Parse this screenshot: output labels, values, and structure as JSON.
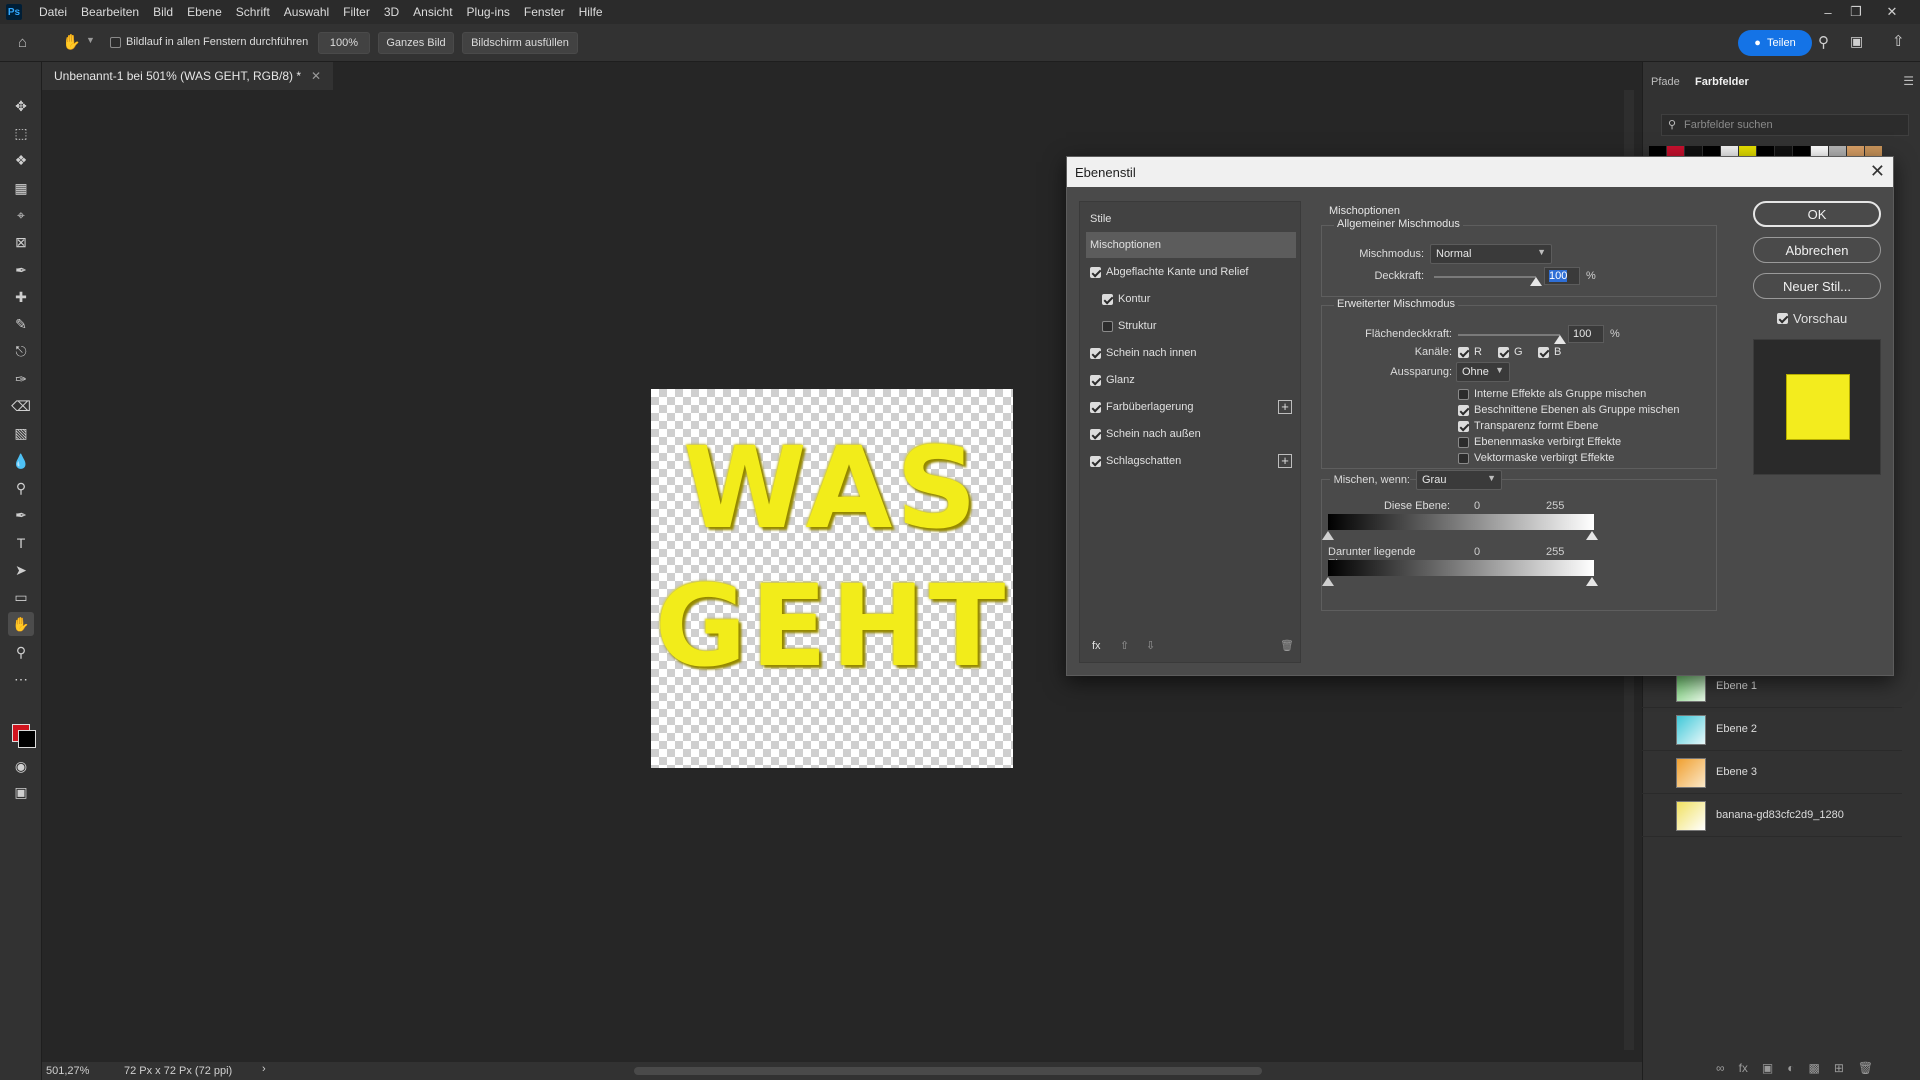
{
  "menubar": {
    "logo": "Ps",
    "items": [
      "Datei",
      "Bearbeiten",
      "Bild",
      "Ebene",
      "Schrift",
      "Auswahl",
      "Filter",
      "3D",
      "Ansicht",
      "Plug-ins",
      "Fenster",
      "Hilfe"
    ]
  },
  "optbar": {
    "scroll_all_label": "Bildlauf in allen Fenstern durchführen",
    "zoom_btn": "100%",
    "fit_btn": "Ganzes Bild",
    "fill_btn": "Bildschirm ausfüllen",
    "share_btn": "Teilen"
  },
  "document": {
    "tab_title": "Unbenannt-1 bei 501% (WAS GEHT, RGB/8) *",
    "line1": "WAS",
    "line2": "GEHT"
  },
  "status": {
    "zoom": "501,27%",
    "size": "72 Px x 72 Px (72 ppi)"
  },
  "right_panel": {
    "tab_paths": "Pfade",
    "tab_swatches": "Farbfelder",
    "search_placeholder": "Farbfelder suchen",
    "swatch_colors": [
      "#000000",
      "#c8102e",
      "#111111",
      "#000000",
      "#f2f2f2",
      "#e6e000",
      "#000000",
      "#111111",
      "#000000",
      "#ffffff",
      "#b5b5b5",
      "#d9a066",
      "#c9945a"
    ],
    "layers": [
      {
        "name": "Ebene 1"
      },
      {
        "name": "Ebene 2"
      },
      {
        "name": "Ebene 3"
      },
      {
        "name": "banana-gd83cfc2d9_1280"
      }
    ]
  },
  "dialog": {
    "title": "Ebenenstil",
    "styles_header": "Stile",
    "styles": [
      {
        "label": "Mischoptionen",
        "checkbox": false,
        "selected": true
      },
      {
        "label": "Abgeflachte Kante und Relief",
        "checked": true
      },
      {
        "label": "Kontur",
        "checked": true
      },
      {
        "label": "Struktur",
        "checked": false
      },
      {
        "label": "Schein nach innen",
        "checked": true
      },
      {
        "label": "Glanz",
        "checked": true
      },
      {
        "label": "Farbüberlagerung",
        "checked": true,
        "plus": true
      },
      {
        "label": "Schein nach außen",
        "checked": true
      },
      {
        "label": "Schlagschatten",
        "checked": true,
        "plus": true
      }
    ],
    "options_title": "Mischoptionen",
    "general_title": "Allgemeiner Mischmodus",
    "blend_mode_label": "Mischmodus:",
    "blend_mode_value": "Normal",
    "opacity_label": "Deckkraft:",
    "opacity_value": "100",
    "percent": "%",
    "advanced_title": "Erweiterter Mischmodus",
    "fill_opacity_label": "Flächendeckkraft:",
    "fill_opacity_value": "100",
    "channels_label": "Kanäle:",
    "channel_r": "R",
    "channel_g": "G",
    "channel_b": "B",
    "knockout_label": "Aussparung:",
    "knockout_value": "Ohne",
    "adv_options": [
      {
        "label": "Interne Effekte als Gruppe mischen",
        "checked": false
      },
      {
        "label": "Beschnittene Ebenen als Gruppe mischen",
        "checked": true
      },
      {
        "label": "Transparenz formt Ebene",
        "checked": true
      },
      {
        "label": "Ebenenmaske verbirgt Effekte",
        "checked": false
      },
      {
        "label": "Vektormaske verbirgt Effekte",
        "checked": false
      }
    ],
    "blend_if_label": "Mischen, wenn:",
    "blend_if_value": "Grau",
    "this_layer_label": "Diese Ebene:",
    "underlying_label": "Darunter liegende Ebene:",
    "range_low": "0",
    "range_high": "255",
    "ok_btn": "OK",
    "cancel_btn": "Abbrechen",
    "new_style_btn": "Neuer Stil...",
    "preview_label": "Vorschau",
    "preview_color": "#f3ec1e"
  }
}
